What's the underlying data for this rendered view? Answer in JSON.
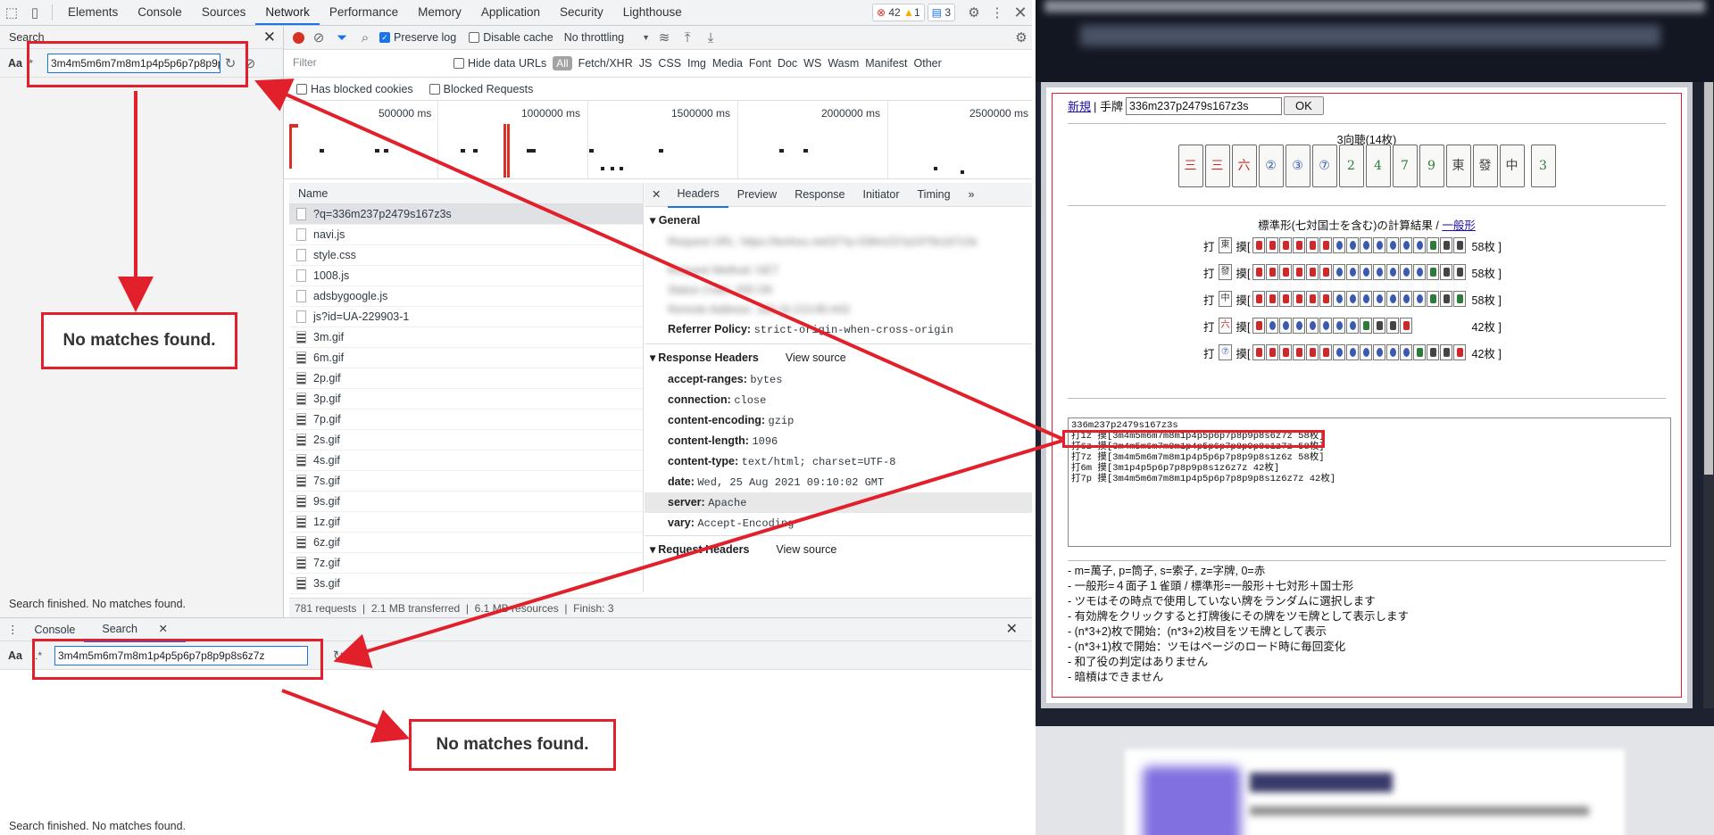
{
  "devtools": {
    "tabs": [
      "Elements",
      "Console",
      "Sources",
      "Network",
      "Performance",
      "Memory",
      "Application",
      "Security",
      "Lighthouse"
    ],
    "active_tab": "Network",
    "errors_count": "42",
    "warnings_count": "1",
    "messages_count": "3"
  },
  "search_panel": {
    "title": "Search",
    "aa_label": "Aa",
    "regex_label": ".*",
    "query": "3m4m5m6m7m8m1p4p5p6p7p8p9p8s6z7z",
    "status": "Search finished.  No matches found."
  },
  "network": {
    "preserve_log_label": "Preserve log",
    "disable_cache_label": "Disable cache",
    "throttling": "No throttling",
    "filter_placeholder": "Filter",
    "hide_data_urls_label": "Hide data URLs",
    "type_filters": [
      "All",
      "Fetch/XHR",
      "JS",
      "CSS",
      "Img",
      "Media",
      "Font",
      "Doc",
      "WS",
      "Wasm",
      "Manifest",
      "Other"
    ],
    "has_blocked_cookies_label": "Has blocked cookies",
    "blocked_requests_label": "Blocked Requests",
    "timeline_ticks": [
      "500000 ms",
      "1000000 ms",
      "1500000 ms",
      "2000000 ms",
      "2500000 ms"
    ],
    "name_header": "Name",
    "requests": [
      "?q=336m237p2479s167z3s",
      "navi.js",
      "style.css",
      "1008.js",
      "adsbygoogle.js",
      "js?id=UA-229903-1",
      "3m.gif",
      "6m.gif",
      "2p.gif",
      "3p.gif",
      "7p.gif",
      "2s.gif",
      "4s.gif",
      "7s.gif",
      "9s.gif",
      "1z.gif",
      "6z.gif",
      "7z.gif",
      "3s.gif"
    ],
    "summary": {
      "requests": "781 requests",
      "transferred": "2.1 MB transferred",
      "resources": "6.1 MB resources",
      "finish": "Finish: 3"
    }
  },
  "details": {
    "tabs": [
      "Headers",
      "Preview",
      "Response",
      "Initiator",
      "Timing"
    ],
    "general_title": "General",
    "general_blurred": [
      "Request URL: https://tenhou.net/2/?q=336m237p2479s167z3s",
      "Request Method: GET",
      "Status Code: 200 OK",
      "Remote Address: 160.16.213.80:443"
    ],
    "referrer_label": "Referrer Policy:",
    "referrer_value": "strict-origin-when-cross-origin",
    "response_headers_title": "Response Headers",
    "view_source": "View source",
    "response_headers": [
      {
        "k": "accept-ranges:",
        "v": "bytes"
      },
      {
        "k": "connection:",
        "v": "close"
      },
      {
        "k": "content-encoding:",
        "v": "gzip"
      },
      {
        "k": "content-length:",
        "v": "1096"
      },
      {
        "k": "content-type:",
        "v": "text/html; charset=UTF-8"
      },
      {
        "k": "date:",
        "v": "Wed, 25 Aug 2021 09:10:02 GMT"
      },
      {
        "k": "server:",
        "v": "Apache"
      },
      {
        "k": "vary:",
        "v": "Accept-Encoding"
      }
    ],
    "request_headers_title": "Request Headers"
  },
  "drawer": {
    "tabs": [
      "Console",
      "Search"
    ],
    "active_tab": "Search",
    "aa_label": "Aa",
    "regex_label": ".*",
    "query": "3m4m5m6m7m8m1p4p5p6p7p8p9p8s6z7z",
    "status": "Search finished.  No matches found."
  },
  "annotations": {
    "no_matches_top": "No matches found.",
    "no_matches_bottom": "No matches found."
  },
  "webpage": {
    "new_link": "新規",
    "hand_label": "| 手牌",
    "hand_input": "336m237p2479s167z3s",
    "ok_button": "OK",
    "problem_title": "3向聴(14枚)",
    "hand_tiles": [
      "三",
      "三",
      "六",
      "②",
      "③",
      "⑦",
      "2",
      "4",
      "7",
      "9",
      "東",
      "發",
      "中",
      "3"
    ],
    "result_title": "標準形(七対国士を含む)の計算結果 / ",
    "result_link": "一般形",
    "discard_rows": [
      {
        "discard_label": "打",
        "discard": "東",
        "draw_label": "摸[",
        "count": "58枚 ]",
        "tiles": [
          "m",
          "m",
          "m",
          "m",
          "m",
          "m",
          "p",
          "p",
          "p",
          "p",
          "p",
          "p",
          "p",
          "s",
          "z",
          "z"
        ]
      },
      {
        "discard_label": "打",
        "discard": "發",
        "draw_label": "摸[",
        "count": "58枚 ]",
        "tiles": [
          "m",
          "m",
          "m",
          "m",
          "m",
          "m",
          "p",
          "p",
          "p",
          "p",
          "p",
          "p",
          "p",
          "s",
          "z",
          "z"
        ]
      },
      {
        "discard_label": "打",
        "discard": "中",
        "draw_label": "摸[",
        "count": "58枚 ]",
        "tiles": [
          "m",
          "m",
          "m",
          "m",
          "m",
          "m",
          "p",
          "p",
          "p",
          "p",
          "p",
          "p",
          "p",
          "s",
          "z",
          "s"
        ]
      },
      {
        "discard_label": "打",
        "discard": "六",
        "draw_label": "摸[",
        "count": "42枚 ]",
        "tiles": [
          "m",
          "p",
          "p",
          "p",
          "p",
          "p",
          "p",
          "p",
          "s",
          "z",
          "z",
          "m"
        ]
      },
      {
        "discard_label": "打",
        "discard": "⑦",
        "draw_label": "摸[",
        "count": "42枚 ]",
        "tiles": [
          "m",
          "m",
          "m",
          "m",
          "m",
          "m",
          "p",
          "p",
          "p",
          "p",
          "p",
          "p",
          "s",
          "z",
          "z",
          "m"
        ]
      }
    ],
    "textarea_lines": [
      "336m237p2479s167z3s",
      "打1z 摸[3m4m5m6m7m8m1p4p5p6p7p8p9p8s6z7z 58枚]",
      "打6z 摸[3m4m5m6m7m8m1p4p5p6p7p8p9p8s1z7z 58枚]",
      "打7z 摸[3m4m5m6m7m8m1p4p5p6p7p8p9p8s1z6z 58枚]",
      "打6m 摸[3m1p4p5p6p7p8p9p8s1z6z7z 42枚]",
      "打7p 摸[3m4m5m6m7m8m1p4p5p6p7p8p9p8s1z6z7z 42枚]"
    ],
    "notes": [
      "- m=萬子, p=筒子, s=索子, z=字牌, 0=赤",
      "- 一般形=４面子１雀頭 / 標準形=一般形＋七対形＋国士形",
      "- ツモはその時点で使用していない牌をランダムに選択します",
      "- 有効牌をクリックすると打牌後にその牌をツモ牌として表示します",
      "- (n*3+2)枚で開始：(n*3+2)枚目をツモ牌として表示",
      "- (n*3+1)枚で開始：ツモはページのロード時に毎回変化",
      "- 和了役の判定はありません",
      "- 暗槓はできません"
    ],
    "colors": {
      "man": "#cc2a2a",
      "pin": "#3a5ab0",
      "sou": "#2e7a3a",
      "honor": "#444444"
    }
  }
}
